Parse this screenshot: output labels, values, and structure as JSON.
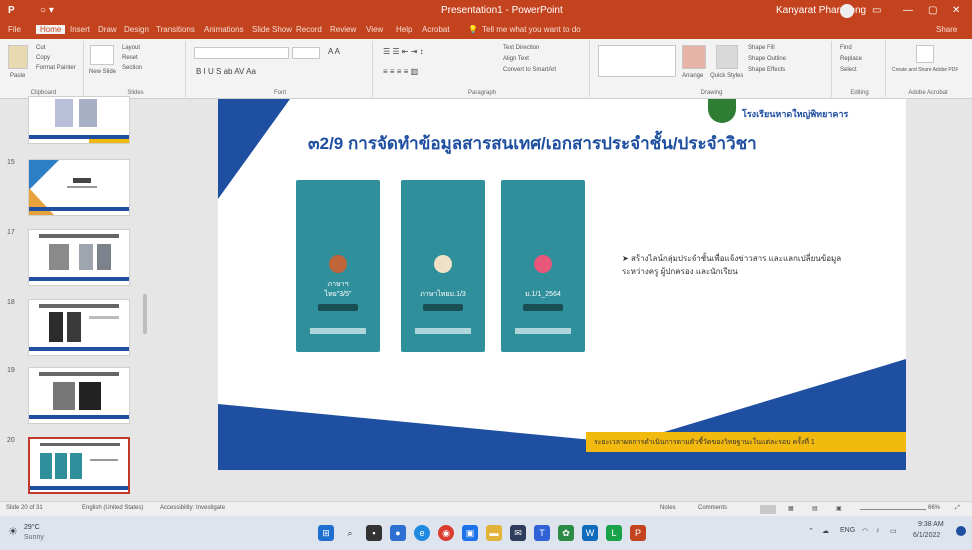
{
  "window": {
    "title": "Presentation1 - PowerPoint",
    "user": "Kanyarat Phanwong",
    "share": "Share"
  },
  "tabs": [
    "File",
    "Home",
    "Insert",
    "Draw",
    "Design",
    "Transitions",
    "Animations",
    "Slide Show",
    "Record",
    "Review",
    "View",
    "Help",
    "Acrobat"
  ],
  "tell_me": "Tell me what you want to do",
  "ribbon": {
    "groups": [
      "Clipboard",
      "Slides",
      "Font",
      "Paragraph",
      "Drawing",
      "Editing",
      "Adobe Acrobat"
    ],
    "clipboard": {
      "paste": "Paste",
      "cut": "Cut",
      "copy": "Copy",
      "format_painter": "Format Painter"
    },
    "slides": {
      "new_slide": "New Slide",
      "layout": "Layout",
      "reset": "Reset",
      "section": "Section"
    },
    "paragraph": {
      "text_direction": "Text Direction",
      "align_text": "Align Text",
      "convert": "Convert to SmartArt"
    },
    "drawing": {
      "arrange": "Arrange",
      "quick_styles": "Quick Styles",
      "fill": "Shape Fill",
      "outline": "Shape Outline",
      "effects": "Shape Effects"
    },
    "editing": {
      "find": "Find",
      "replace": "Replace",
      "select": "Select"
    },
    "acrobat": {
      "create": "Create and Share Adobe PDF"
    }
  },
  "slide_panel": {
    "numbers": [
      "",
      "15",
      "17",
      "18",
      "19",
      "20"
    ]
  },
  "slide": {
    "title": "๓2/9 การจัดทำข้อมูลสารสนเทศ/เอกสารประจำชั้น/ประจำวิชา",
    "logo_text": "โรงเรียนหาดใหญ่พิทยาคาร",
    "phones": [
      {
        "name1": "ภาษาฯ",
        "name2": "ไทย\"3/5\""
      },
      {
        "name1": "",
        "name2": "ภาษาไทยม.1/3"
      },
      {
        "name1": "",
        "name2": "ม.1/1_2564"
      }
    ],
    "bullet": "สร้างไลน์กลุ่มประจำชั้นเพื่อแจ้งข่าวสาร และแลกเปลี่ยนข้อมูลระหว่างครู ผู้ปกครอง และนักเรียน",
    "banner": "ระยะเวลาผลการดำเนินการตามตัวชี้วัดของวิทยฐานะในแต่ละรอบ ครั้งที่ 1"
  },
  "statusbar": {
    "slide_info": "Slide 20 of 31",
    "language": "English (United States)",
    "accessibility": "Accessibility: Investigate",
    "notes": "Notes",
    "comments": "Comments",
    "zoom": "66%"
  },
  "taskbar": {
    "weather_temp": "29°C",
    "weather_text": "Sunny",
    "lang": "ENG",
    "time": "9:38 AM",
    "date": "6/1/2022"
  },
  "colors": {
    "accent": "#c4431f",
    "slide_blue": "#1f4fa0",
    "phone_teal": "#2f8f9a",
    "banner_yellow": "#f2b90f"
  }
}
